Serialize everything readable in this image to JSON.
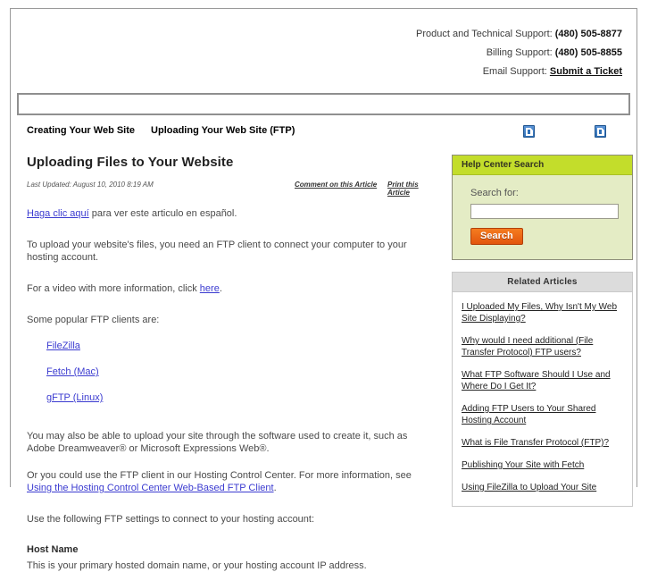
{
  "support": {
    "rows": [
      {
        "label": "Product and Technical Support: ",
        "value": "(480) 505-8877",
        "type": "value"
      },
      {
        "label": "Billing Support: ",
        "value": "(480) 505-8855",
        "type": "value"
      },
      {
        "label": "Email Support: ",
        "value": "Submit a Ticket",
        "type": "link"
      }
    ]
  },
  "nav": {
    "search_bar_value": "",
    "search_bar_placeholder": ""
  },
  "breadcrumb": {
    "items": [
      {
        "label": "Creating Your Web Site"
      },
      {
        "label": "Uploading Your Web Site (FTP)"
      }
    ],
    "icons": [
      {
        "name": "broken-image-icon"
      },
      {
        "name": "broken-image-icon"
      }
    ]
  },
  "article": {
    "title": "Uploading Files to Your Website",
    "last_updated": "Last Updated: August 10, 2010 8:19 AM",
    "comment_link": "Comment on this Article",
    "print_link": "Print this Article",
    "spanish_link": "Haga clic aquí",
    "spanish_rest": " para ver este articulo en español.",
    "para_intro": "To upload your website's files, you need an FTP client to connect your computer to your hosting account.",
    "para_video_pre": "For a video with more information, click ",
    "para_video_link": "here",
    "para_video_post": ".",
    "clients_intro": "Some popular FTP clients are:",
    "clients": [
      {
        "label": "FileZilla"
      },
      {
        "label": "Fetch (Mac)"
      },
      {
        "label": "gFTP (Linux)"
      }
    ],
    "para_software": "You may also be able to upload your site through the software used to create it, such as Adobe Dreamweaver® or Microsoft Expressions Web®.",
    "para_hcc_pre": "Or you could use the FTP client in our Hosting Control Center. For more information, see ",
    "para_hcc_link": "Using the Hosting Control Center Web-Based FTP Client",
    "para_hcc_post": ".",
    "para_settings": "Use the following FTP settings to connect to your hosting account:",
    "host_name_heading": "Host Name",
    "host_name_text": "This is your primary hosted domain name, or your hosting account IP address."
  },
  "help_search": {
    "header": "Help Center Search",
    "label": "Search for:",
    "input_value": "",
    "input_placeholder": "",
    "button": "Search"
  },
  "related": {
    "header": "Related Articles",
    "items": [
      {
        "label": "I Uploaded My Files, Why Isn't My Web Site Displaying?"
      },
      {
        "label": "Why would I need additional (File Transfer Protocol) FTP users?"
      },
      {
        "label": "What FTP Software Should I Use and Where Do I Get It?"
      },
      {
        "label": "Adding FTP Users to Your Shared Hosting Account"
      },
      {
        "label": "What is File Transfer Protocol (FTP)?"
      },
      {
        "label": "Publishing Your Site with Fetch"
      },
      {
        "label": "Using FileZilla to Upload Your Site"
      }
    ]
  },
  "colors": {
    "help_header_green": "#c3dd2b",
    "help_body_green": "#e4ecc5",
    "search_button_orange": "#e2550d",
    "link_blue": "#3b3bd0",
    "related_header_gray": "#dcdcdc"
  }
}
